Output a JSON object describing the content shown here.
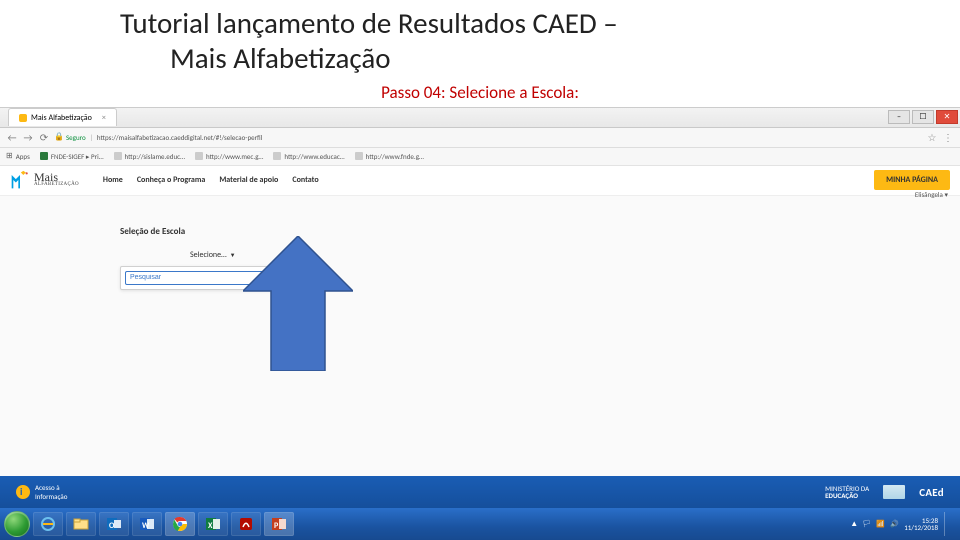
{
  "title_line1": "Tutorial lançamento de Resultados CAED –",
  "title_line2": "Mais Alfabetização",
  "step_label": "Passo 04: Selecione a Escola:",
  "browser": {
    "tab_label": "Mais Alfabetização",
    "security_label": "Seguro",
    "url": "https://maisalfabetizacao.caeddigital.net/#!/selecao-perfil",
    "bookmarks": {
      "apps": "Apps",
      "items": [
        "FNDE-SIGEF ▸ Pri…",
        "http://sislame.educ…",
        "http://www.mec.g…",
        "http://www.educac…",
        "http://www.fnde.g…"
      ]
    },
    "nav": {
      "home": "Home",
      "programa": "Conheça o Programa",
      "material": "Material de apoio",
      "contato": "Contato"
    },
    "cta": "MINHA PÁGINA",
    "user_greeting": "Elisângela ▾",
    "logo_text": "Mais",
    "logo_sub": "ALFABETIZAÇÃO",
    "page": {
      "section_label": "Seleção de Escola",
      "select_placeholder": "Selecione…",
      "search_placeholder": "Pesquisar"
    }
  },
  "footer": {
    "acesso": "Acesso à",
    "info": "Informação",
    "mec_line1": "MINISTÉRIO DA",
    "mec_line2": "EDUCAÇÃO",
    "caed": "CAEd"
  },
  "taskbar": {
    "clock_time": "15:28",
    "clock_date": "11/12/2018"
  }
}
